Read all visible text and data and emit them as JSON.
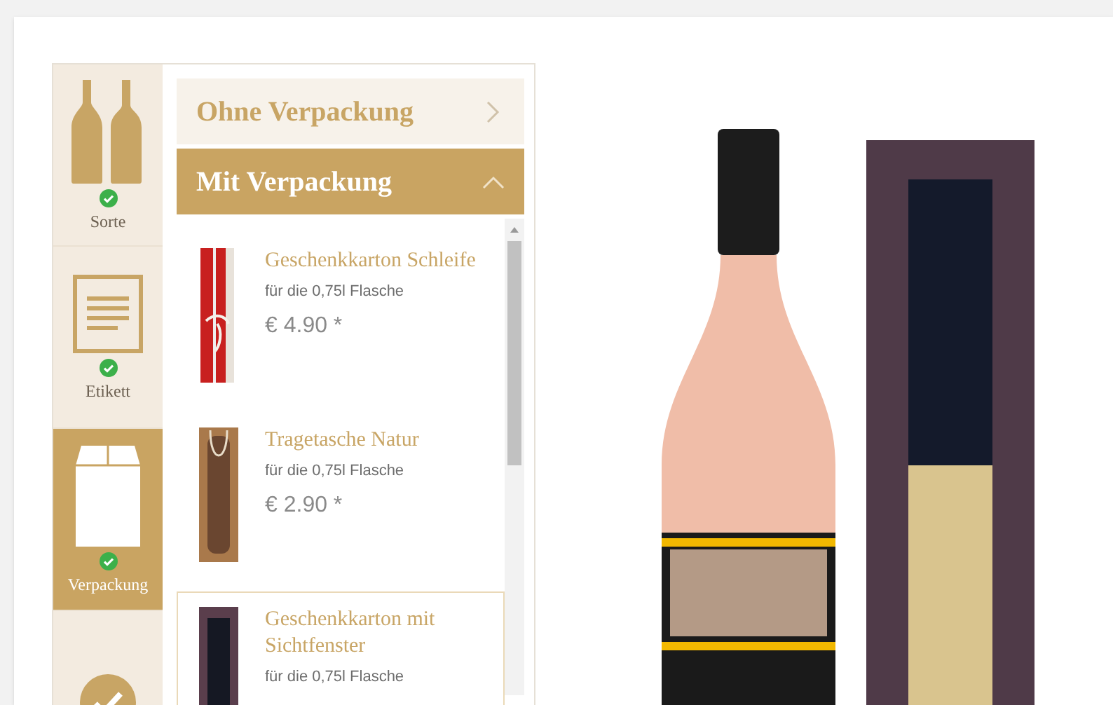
{
  "steps": [
    {
      "kind": "bottles",
      "label": "Sorte",
      "done": true,
      "selected": false
    },
    {
      "kind": "label",
      "label": "Etikett",
      "done": true,
      "selected": false
    },
    {
      "kind": "package",
      "label": "Verpackung",
      "done": true,
      "selected": true
    },
    {
      "kind": "finish",
      "done": false,
      "selected": false
    }
  ],
  "sections": [
    {
      "title": "Ohne Verpackung",
      "expanded": false
    },
    {
      "title": "Mit Verpackung",
      "expanded": true
    }
  ],
  "products": [
    {
      "kind": "red-box",
      "title": "Geschenkkarton Schleife",
      "subtitle": "für die 0,75l Flasche",
      "price": "€ 4.90 *",
      "selected": false
    },
    {
      "kind": "bag",
      "title": "Tragetasche Natur",
      "subtitle": "für die 0,75l Flasche",
      "price": "€ 2.90 *",
      "selected": false
    },
    {
      "kind": "window-box",
      "title": "Geschenkkarton mit Sichtfenster",
      "subtitle": "für die 0,75l Flasche",
      "selected": true
    }
  ]
}
